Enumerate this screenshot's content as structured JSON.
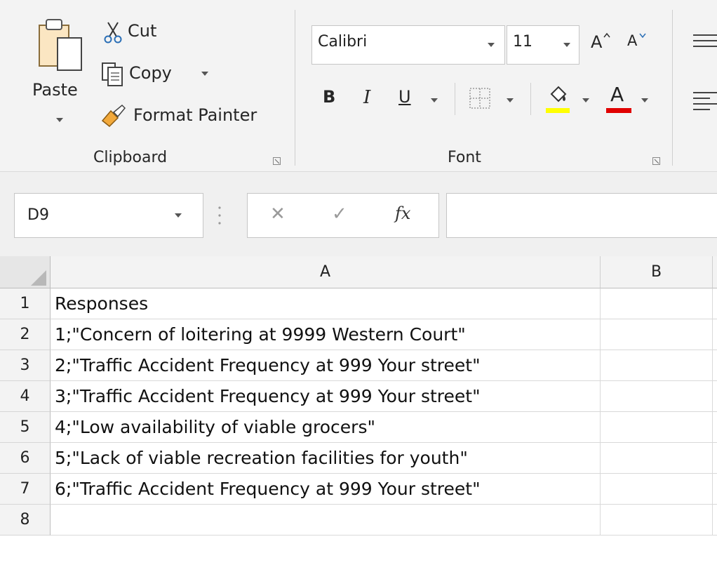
{
  "ribbon": {
    "clipboard": {
      "paste_label": "Paste",
      "cut_label": "Cut",
      "copy_label": "Copy",
      "format_painter_label": "Format Painter",
      "group_label": "Clipboard"
    },
    "font": {
      "font_name": "Calibri",
      "font_size": "11",
      "increase_size_label": "A",
      "decrease_size_label": "A",
      "bold_label": "B",
      "italic_label": "I",
      "underline_label": "U",
      "font_color_label": "A",
      "group_label": "Font",
      "highlight_color": "#ffff00",
      "font_color": "#e00000"
    }
  },
  "formula_bar": {
    "name_box": "D9",
    "cancel_symbol": "✕",
    "enter_symbol": "✓",
    "fx_symbol": "fx",
    "formula": ""
  },
  "sheet": {
    "columns": [
      "A",
      "B"
    ],
    "rows": [
      {
        "num": "1",
        "a": "Responses",
        "b": ""
      },
      {
        "num": "2",
        "a": "1;\"Concern of loitering at 9999 Western Court\"",
        "b": ""
      },
      {
        "num": "3",
        "a": "2;\"Traffic Accident Frequency at 999 Your street\"",
        "b": ""
      },
      {
        "num": "4",
        "a": "3;\"Traffic Accident Frequency at 999 Your street\"",
        "b": ""
      },
      {
        "num": "5",
        "a": "4;\"Low availability of viable grocers\"",
        "b": ""
      },
      {
        "num": "6",
        "a": "5;\"Lack of viable recreation facilities for youth\"",
        "b": ""
      },
      {
        "num": "7",
        "a": "6;\"Traffic Accident Frequency at 999 Your street\"",
        "b": ""
      },
      {
        "num": "8",
        "a": "",
        "b": ""
      }
    ]
  }
}
